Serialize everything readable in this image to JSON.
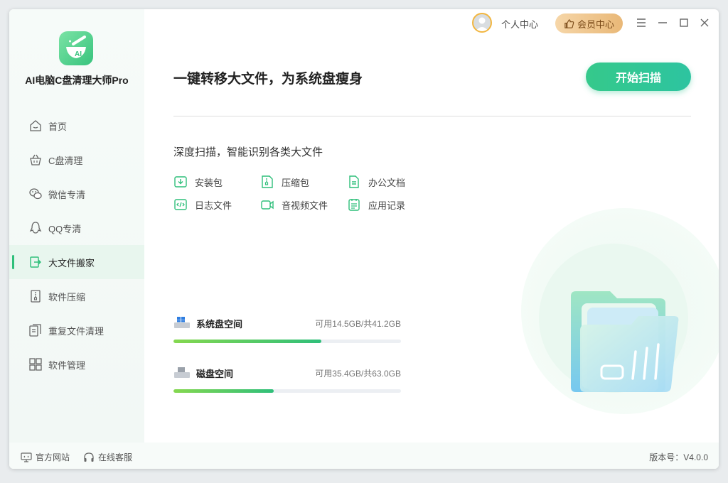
{
  "app": {
    "name": "AI电脑C盘清理大师Pro"
  },
  "topbar": {
    "user_center": "个人中心",
    "vip_center": "会员中心"
  },
  "sidebar": {
    "items": [
      {
        "label": "首页",
        "icon": "home-icon",
        "active": false
      },
      {
        "label": "C盘清理",
        "icon": "basket-icon",
        "active": false
      },
      {
        "label": "微信专清",
        "icon": "wechat-icon",
        "active": false
      },
      {
        "label": "QQ专清",
        "icon": "qq-icon",
        "active": false
      },
      {
        "label": "大文件搬家",
        "icon": "file-move-icon",
        "active": true
      },
      {
        "label": "软件压缩",
        "icon": "compress-icon",
        "active": false
      },
      {
        "label": "重复文件清理",
        "icon": "duplicate-icon",
        "active": false
      },
      {
        "label": "软件管理",
        "icon": "apps-icon",
        "active": false
      }
    ]
  },
  "main": {
    "title": "一键转移大文件，为系统盘瘦身",
    "scan_button": "开始扫描",
    "subtitle": "深度扫描，智能识别各类大文件",
    "file_types": [
      {
        "label": "安装包",
        "icon": "install-package-icon"
      },
      {
        "label": "压缩包",
        "icon": "zip-icon"
      },
      {
        "label": "办公文档",
        "icon": "document-icon"
      },
      {
        "label": "日志文件",
        "icon": "log-icon"
      },
      {
        "label": "音视频文件",
        "icon": "video-icon"
      },
      {
        "label": "应用记录",
        "icon": "app-record-icon"
      }
    ],
    "disks": [
      {
        "name": "系统盘空间",
        "free": "可用14.5GB/共41.2GB",
        "used_fraction": 0.65
      },
      {
        "name": "磁盘空间",
        "free": "可用35.4GB/共63.0GB",
        "used_fraction": 0.44
      }
    ]
  },
  "footer": {
    "website": "官方网站",
    "support": "在线客服",
    "version": "版本号：V4.0.0"
  },
  "colors": {
    "accent": "#2fbf7a",
    "vip": "#e9b877"
  }
}
